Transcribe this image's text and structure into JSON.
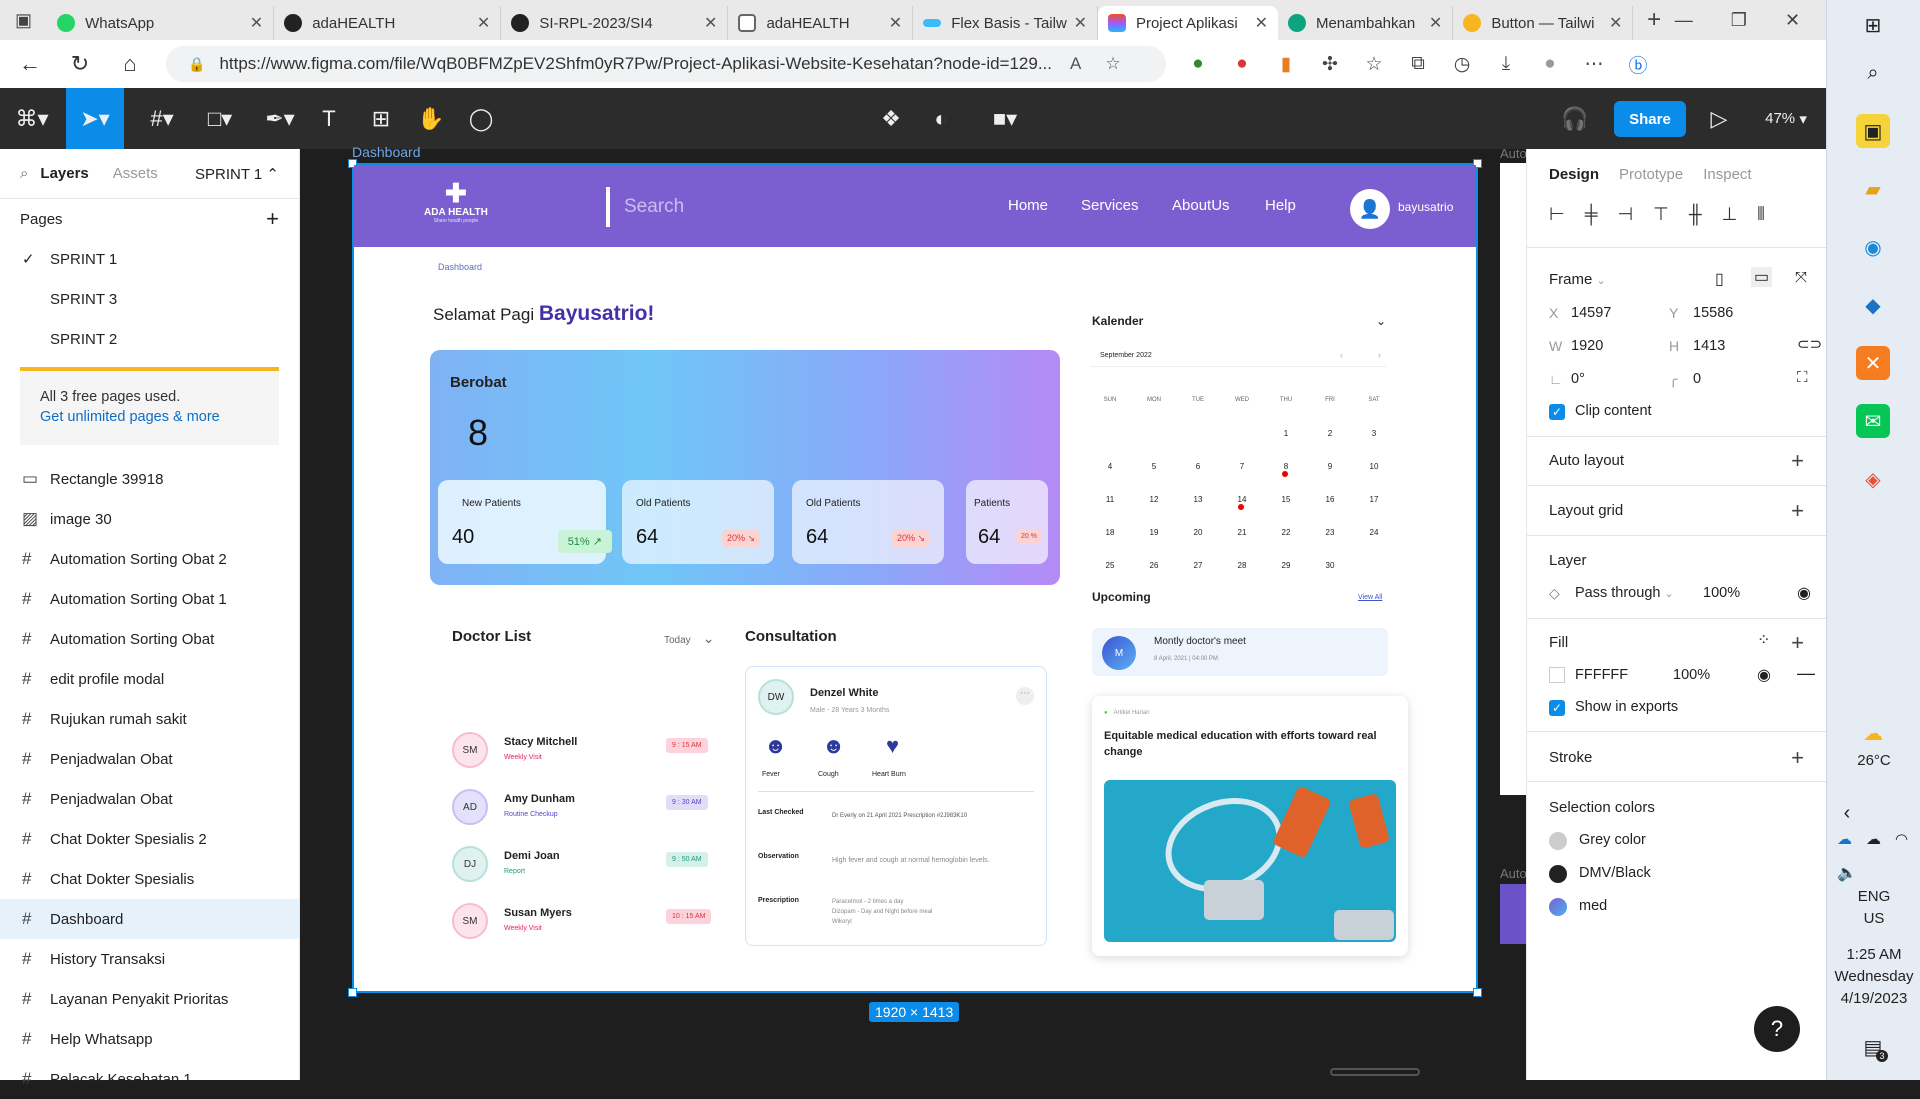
{
  "browser": {
    "tabs": [
      {
        "label": "WhatsApp",
        "color": "#25d366"
      },
      {
        "label": "adaHEALTH",
        "color": "#222222"
      },
      {
        "label": "SI-RPL-2023/SI4",
        "color": "#222222"
      },
      {
        "label": "adaHEALTH",
        "color": "#888888"
      },
      {
        "label": "Flex Basis - Tailw",
        "color": "#38bdf8"
      },
      {
        "label": "Project Aplikasi",
        "color": "#f24e1e"
      },
      {
        "label": "Menambahkan",
        "color": "#10a37f"
      },
      {
        "label": "Button — Tailwi",
        "color": "#f5b621"
      }
    ],
    "url": "https://www.figma.com/file/WqB0BFMZpEV2Shfm0yR7Pw/Project-Aplikasi-Website-Kesehatan?node-id=129..."
  },
  "figma": {
    "zoom": "47%",
    "share": "Share",
    "left": {
      "tabs": [
        "Layers",
        "Assets"
      ],
      "sprint": "SPRINT 1 ⌃",
      "pages_title": "Pages",
      "pages": [
        "SPRINT 1",
        "SPRINT 3",
        "SPRINT 2"
      ],
      "notice": "All 3 free pages used.",
      "notice_link": "Get unlimited pages & more",
      "layers": [
        "Rectangle 39918",
        "image 30",
        "Automation Sorting Obat 2",
        "Automation Sorting Obat 1",
        "Automation Sorting Obat",
        "edit profile modal",
        "Rujukan rumah sakit",
        "Penjadwalan Obat",
        "Penjadwalan Obat",
        "Chat Dokter Spesialis 2",
        "Chat Dokter Spesialis",
        "Dashboard",
        "History Transaksi",
        "Layanan Penyakit Prioritas",
        "Help Whatsapp",
        "Pelacak Kesehatan 1"
      ]
    },
    "canvas": {
      "frame_label": "Dashboard",
      "size_badge": "1920 × 1413",
      "side_label": "Auto"
    },
    "right": {
      "tabs": [
        "Design",
        "Prototype",
        "Inspect"
      ],
      "frame": "Frame",
      "x": "14597",
      "y": "15586",
      "w": "1920",
      "h": "1413",
      "rotation": "0°",
      "radius": "0",
      "clip": "Clip content",
      "auto_layout": "Auto layout",
      "layout_grid": "Layout grid",
      "layer": "Layer",
      "blend": "Pass through",
      "opacity": "100%",
      "fill": "Fill",
      "fill_hex": "FFFFFF",
      "fill_opacity": "100%",
      "show_exports": "Show in exports",
      "stroke": "Stroke",
      "selection_colors": "Selection colors",
      "colors": [
        {
          "name": "Grey color",
          "hex": "#cccccc"
        },
        {
          "name": "DMV/Black",
          "hex": "#222222"
        },
        {
          "name": "med",
          "hex": "#4a7fd8"
        }
      ]
    }
  },
  "app": {
    "brand": "ADA HEALTH",
    "brand_tag": "Share health people",
    "search": "Search",
    "nav": [
      "Home",
      "Services",
      "AboutUs",
      "Help"
    ],
    "user": "bayusatrio",
    "breadcrumb": "Dashboard",
    "greeting": "Selamat Pagi",
    "greeting_name": "Bayusatrio!",
    "berobat_title": "Berobat",
    "berobat_count": "8",
    "patient_cards": [
      {
        "label": "New Patients",
        "value": "40",
        "badge": "51%"
      },
      {
        "label": "Old Patients",
        "value": "64",
        "badge": "20%"
      },
      {
        "label": "Old Patients",
        "value": "64",
        "badge": "20%"
      },
      {
        "label": "Patients",
        "value": "64",
        "badge": "20 %"
      }
    ],
    "doctor_list_title": "Doctor List",
    "doctor_filter": "Today",
    "doctors": [
      {
        "initials": "SM",
        "name": "Stacy Mitchell",
        "sub": "Weekly Visit",
        "time": "9 : 15 AM",
        "color": "#fce4ec"
      },
      {
        "initials": "AD",
        "name": "Amy Dunham",
        "sub": "Routine Checkup",
        "time": "9 : 30 AM",
        "color": "#e3e1fb"
      },
      {
        "initials": "DJ",
        "name": "Demi Joan",
        "sub": "Report",
        "time": "9 : 50 AM",
        "color": "#e0f2ef"
      },
      {
        "initials": "SM",
        "name": "Susan Myers",
        "sub": "Weekly Visit",
        "time": "10 : 15 AM",
        "color": "#fce4ec"
      }
    ],
    "consultation_title": "Consultation",
    "patient": {
      "initials": "DW",
      "name": "Denzel White",
      "meta": "Male - 28 Years 3 Months"
    },
    "symptoms": [
      "Fever",
      "Cough",
      "Heart Burn"
    ],
    "last_checked_label": "Last Checked",
    "last_checked": "Dr Everly on 21 April 2021 Prescription #2J983K10",
    "observation_label": "Observation",
    "observation": "High fever and cough at normal hemoglobin levels.",
    "prescription_label": "Prescription",
    "prescription": [
      "Paracetmol - 2 times a day",
      "Dizopam - Day and Night before meal",
      "Wikoryl"
    ],
    "calendar_title": "Kalender",
    "calendar_month": "September 2022",
    "weekdays": [
      "SUN",
      "MON",
      "TUE",
      "WED",
      "THU",
      "FRI",
      "SAT"
    ],
    "days": [
      "1",
      "2",
      "3",
      "4",
      "5",
      "6",
      "7",
      "8",
      "9",
      "10",
      "11",
      "12",
      "13",
      "14",
      "15",
      "16",
      "17",
      "18",
      "19",
      "20",
      "21",
      "22",
      "23",
      "24",
      "25",
      "26",
      "27",
      "28",
      "29",
      "30"
    ],
    "upcoming_title": "Upcoming",
    "view_all": "View All",
    "upcoming": {
      "initial": "M",
      "title": "Montly doctor's meet",
      "date": "8 April, 2021  |  04:00 PM"
    },
    "article_tag": "Artikel Harian",
    "article_title": "Equitable medical education with efforts toward real change"
  },
  "taskbar": {
    "weather": "26°C",
    "lang1": "ENG",
    "lang2": "US",
    "time": "1:25 AM",
    "day": "Wednesday",
    "date": "4/19/2023",
    "notif": "3"
  }
}
